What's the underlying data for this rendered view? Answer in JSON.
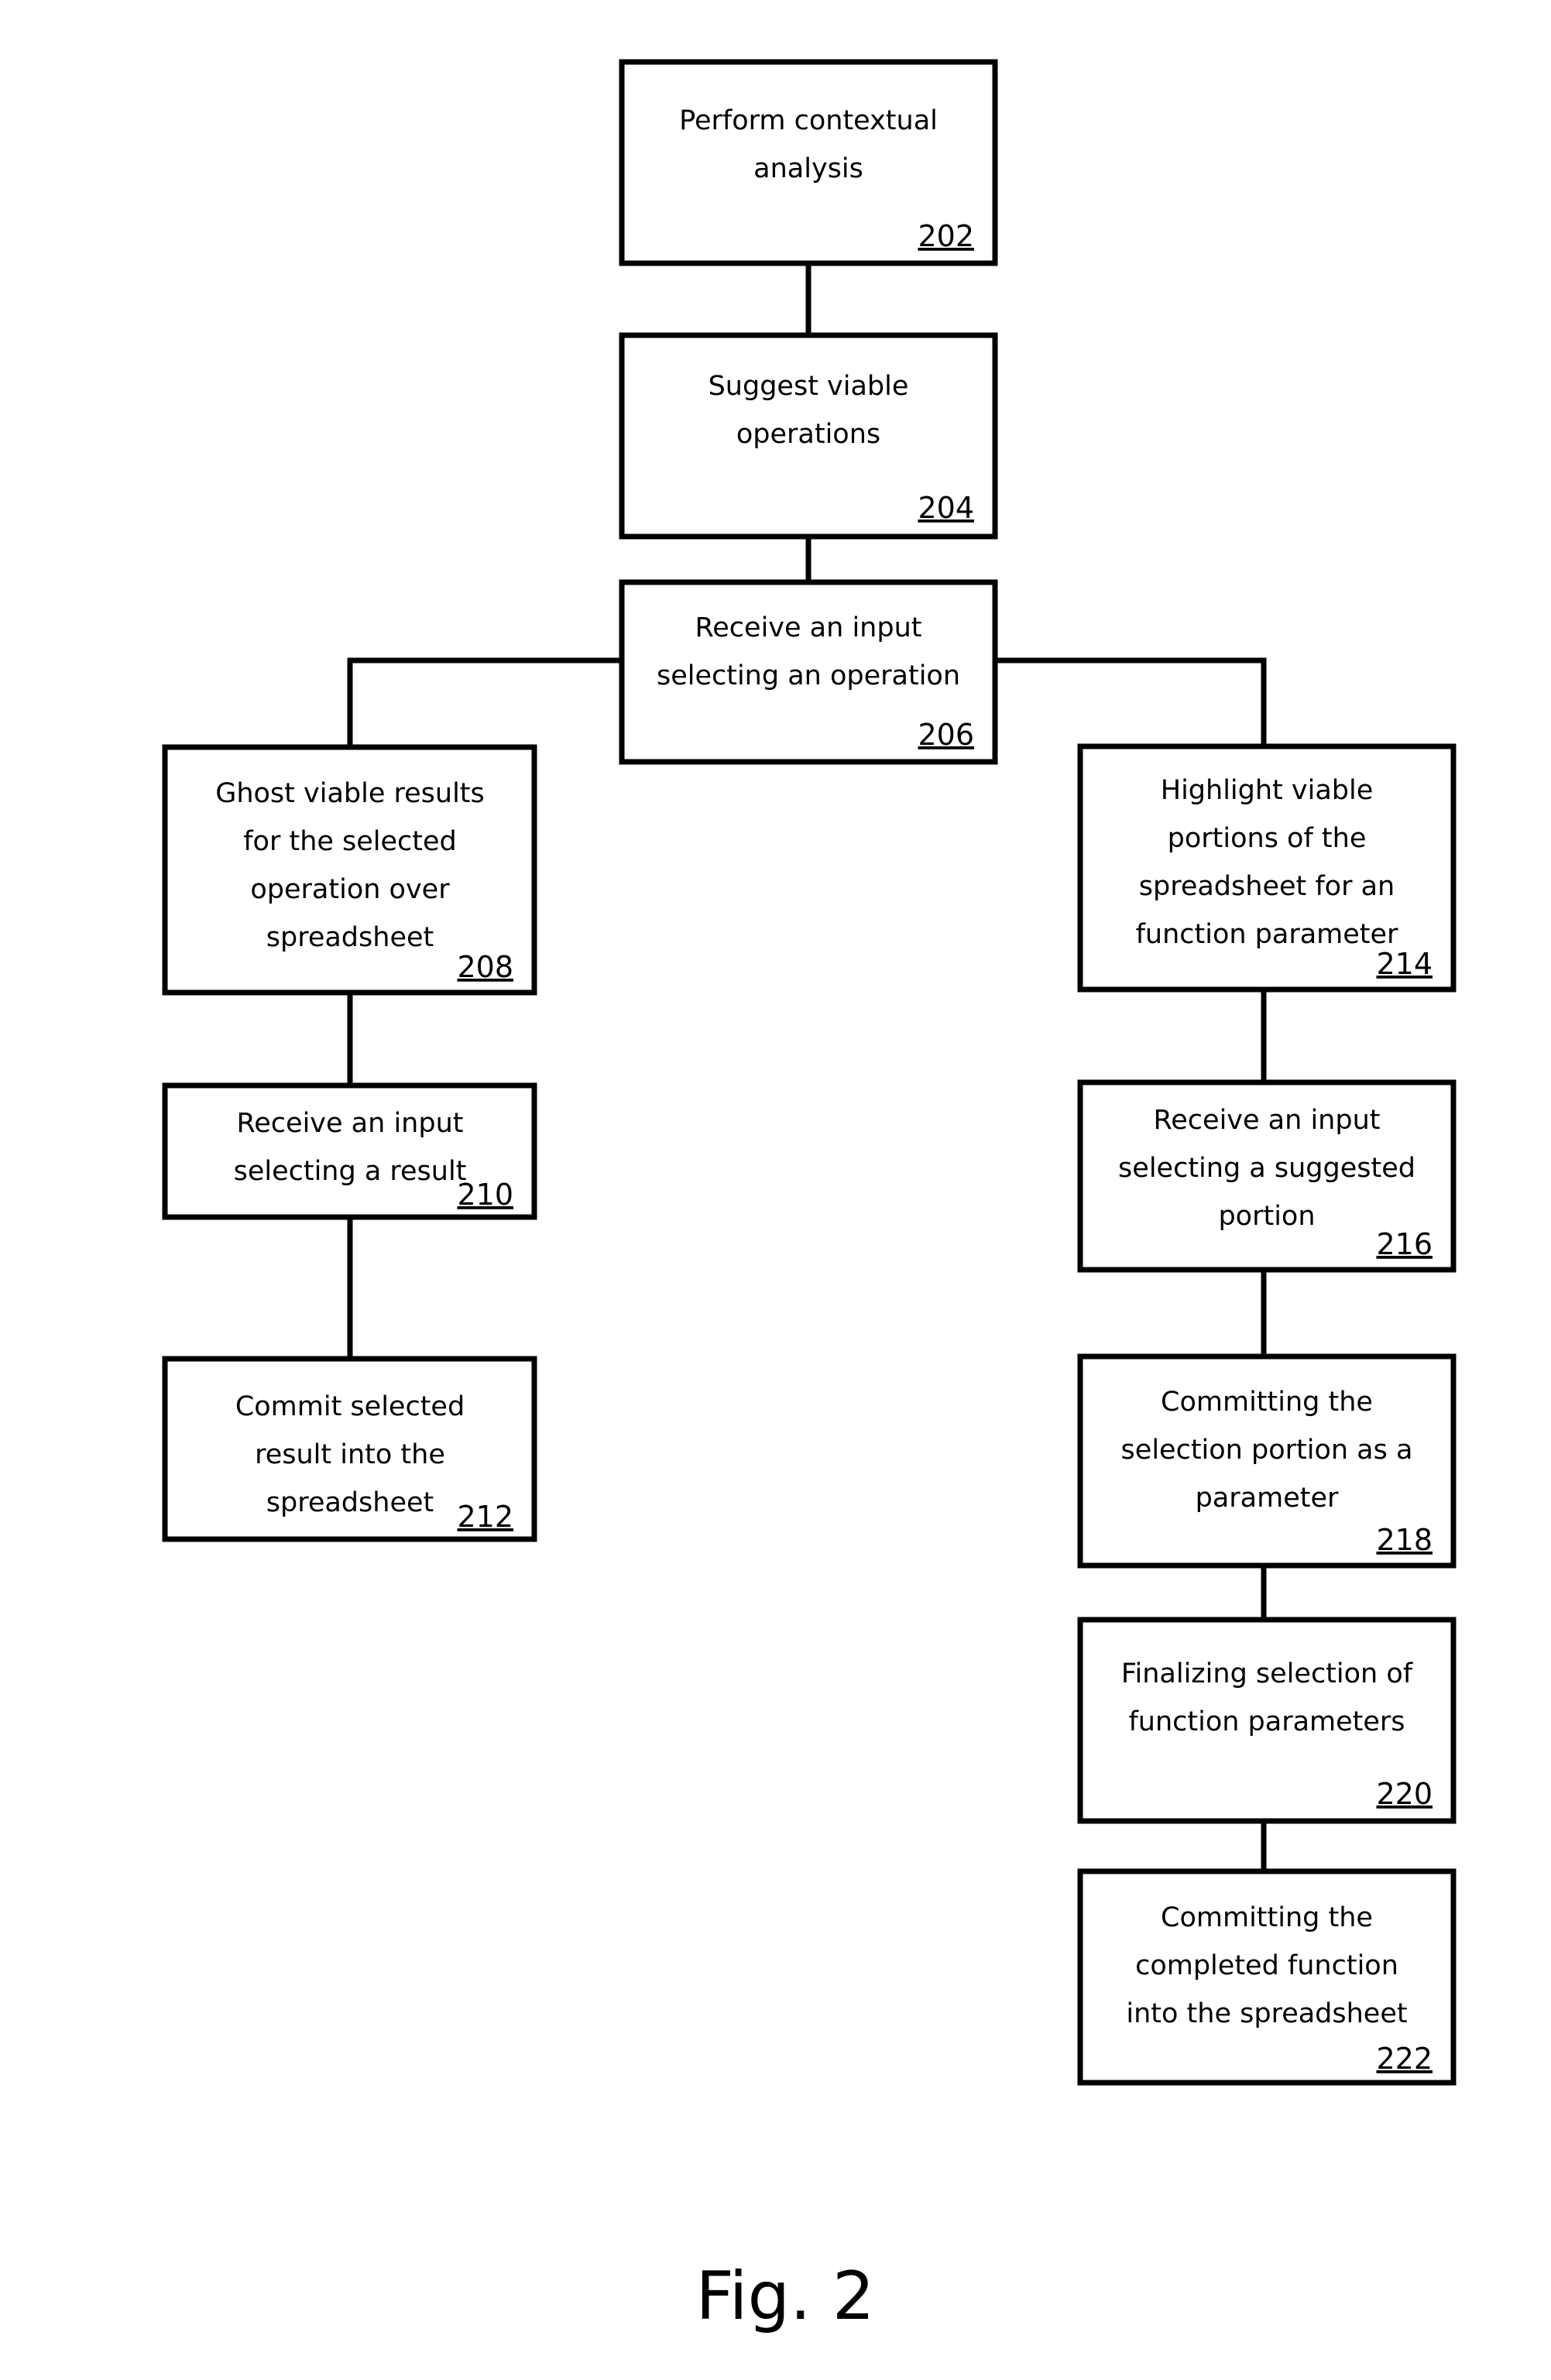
{
  "figure": {
    "caption": "Fig. 2",
    "background_color": "#ffffff",
    "line_color": "#000000"
  },
  "nodes": {
    "n202": {
      "ref": "202",
      "lines": [
        "Perform contextual",
        "analysis"
      ],
      "line1": "Perform contextual",
      "line2": "analysis",
      "line3": "",
      "line4": ""
    },
    "n204": {
      "ref": "204",
      "lines": [
        "Suggest viable",
        "operations"
      ],
      "line1": "Suggest viable",
      "line2": "operations",
      "line3": "",
      "line4": ""
    },
    "n206": {
      "ref": "206",
      "lines": [
        "Receive an input",
        "selecting an operation"
      ],
      "line1": "Receive an input",
      "line2": "selecting an operation",
      "line3": "",
      "line4": ""
    },
    "n208": {
      "ref": "208",
      "lines": [
        "Ghost viable results",
        "for the selected",
        "operation over",
        "spreadsheet"
      ],
      "line1": "Ghost viable results",
      "line2": "for the selected",
      "line3": "operation over",
      "line4": "spreadsheet"
    },
    "n210": {
      "ref": "210",
      "lines": [
        "Receive an input",
        "selecting a result"
      ],
      "line1": "Receive an input",
      "line2": "selecting a result",
      "line3": "",
      "line4": ""
    },
    "n212": {
      "ref": "212",
      "lines": [
        "Commit selected",
        "result into the",
        "spreadsheet"
      ],
      "line1": "Commit selected",
      "line2": "result into the",
      "line3": "spreadsheet",
      "line4": ""
    },
    "n214": {
      "ref": "214",
      "lines": [
        "Highlight viable",
        "portions of the",
        "spreadsheet for an",
        "function parameter"
      ],
      "line1": "Highlight viable",
      "line2": "portions of the",
      "line3": "spreadsheet for an",
      "line4": "function parameter"
    },
    "n216": {
      "ref": "216",
      "lines": [
        "Receive an input",
        "selecting a suggested",
        "portion"
      ],
      "line1": "Receive an input",
      "line2": "selecting a suggested",
      "line3": "portion",
      "line4": ""
    },
    "n218": {
      "ref": "218",
      "lines": [
        "Committing the",
        "selection portion as a",
        "parameter"
      ],
      "line1": "Committing the",
      "line2": "selection portion as a",
      "line3": "parameter",
      "line4": ""
    },
    "n220": {
      "ref": "220",
      "lines": [
        "Finalizing selection of",
        "function parameters"
      ],
      "line1": "Finalizing selection of",
      "line2": "function parameters",
      "line3": "",
      "line4": ""
    },
    "n222": {
      "ref": "222",
      "lines": [
        "Committing the",
        "completed function",
        "into the spreadsheet"
      ],
      "line1": "Committing the",
      "line2": "completed function",
      "line3": "into the spreadsheet",
      "line4": ""
    }
  },
  "edges": [
    {
      "from": "202",
      "to": "204"
    },
    {
      "from": "204",
      "to": "206"
    },
    {
      "from": "206",
      "to": "208"
    },
    {
      "from": "206",
      "to": "214"
    },
    {
      "from": "208",
      "to": "210"
    },
    {
      "from": "210",
      "to": "212"
    },
    {
      "from": "214",
      "to": "216"
    },
    {
      "from": "216",
      "to": "218"
    },
    {
      "from": "218",
      "to": "220"
    },
    {
      "from": "220",
      "to": "222"
    }
  ]
}
